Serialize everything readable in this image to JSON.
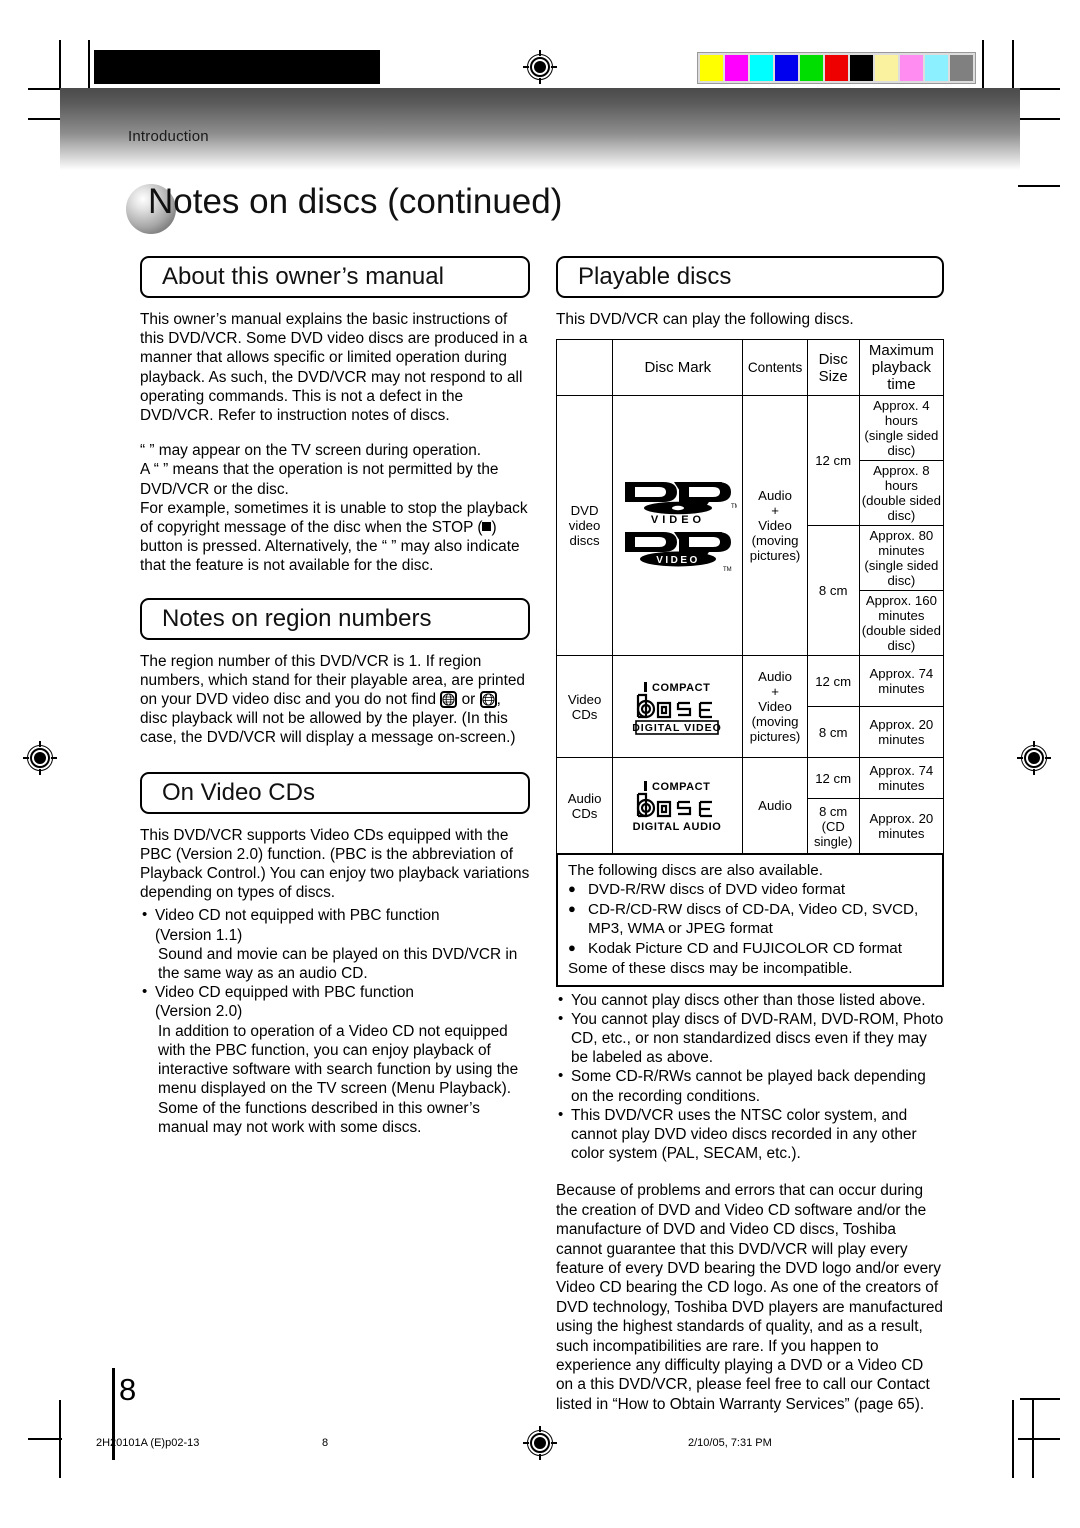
{
  "header": {
    "section_label": "Introduction",
    "page_title": "Notes on discs (continued)",
    "color_bar": [
      "#FFFF00",
      "#FF00FF",
      "#00FFFF",
      "#0000EE",
      "#00DD00",
      "#EE0000",
      "#000000",
      "#FBF2A0",
      "#FF8CF0",
      "#8CF0FF",
      "#808080"
    ]
  },
  "left": {
    "about": {
      "heading": "About this owner’s manual",
      "p1": "This owner’s manual explains the basic instructions of this DVD/VCR. Some DVD video discs are produced in a manner that allows specific or limited operation during playback. As such, the DVD/VCR may not respond to all operating commands. This is not a defect in the DVD/VCR. Refer to instruction notes of discs.",
      "p2_a": "“      ” may appear on the TV screen during operation.",
      "p2_b": "A “      ” means that the operation is not permitted by the DVD/VCR or the disc.",
      "p2_c_1": "For example, sometimes it is unable to stop the playback of copyright message of the disc when the STOP (",
      "p2_c_2": ") button is pressed. Alternatively, the “      ” may also indicate that the feature is not available for the disc."
    },
    "region": {
      "heading": "Notes on region numbers",
      "p1_a": "The region number of this DVD/VCR is 1. If region numbers, which stand for their playable area, are printed on your DVD video disc and you do not find",
      "p1_b": "or",
      "p1_c": ", disc playback will not be allowed by the player. (In this case, the DVD/VCR will display a message on-screen.)"
    },
    "videocds": {
      "heading": "On Video CDs",
      "p1": "This DVD/VCR supports Video CDs equipped with the PBC (Version 2.0) function. (PBC is the abbreviation of Playback Control.) You can enjoy two playback variations depending on types of discs.",
      "bullets": [
        {
          "title": "Video CD not equipped with PBC function",
          "version": "(Version 1.1)",
          "detail": "Sound and movie can be played on this DVD/VCR in the same way as an audio CD."
        },
        {
          "title": "Video CD equipped with PBC function",
          "version": "(Version 2.0)",
          "detail": "In addition to operation of a Video CD not equipped with the PBC function, you can enjoy playback of interactive software with search function by using the menu displayed on the TV screen (Menu Playback). Some of the functions described in this owner’s manual may not work with some discs."
        }
      ]
    }
  },
  "right": {
    "playable": {
      "heading": "Playable discs",
      "intro": "This DVD/VCR can play the following discs.",
      "table": {
        "columns": [
          "",
          "Disc Mark",
          "Contents",
          "Disc Size",
          "Maximum playback time"
        ],
        "col_disc_size_l1": "Disc",
        "col_disc_size_l2": "Size",
        "col_max_l1": "Maximum",
        "col_max_l2": "playback time",
        "rows": [
          {
            "name_l1": "DVD",
            "name_l2": "video",
            "name_l3": "discs",
            "mark": "dvd-video-logo",
            "contents": "Audio\n+\nVideo\n(moving\npictures)",
            "contents_lines": [
              "Audio",
              "+",
              "Video",
              "(moving",
              "pictures)"
            ],
            "sizes": [
              {
                "size": "12 cm",
                "times": [
                  "Approx. 4 hours\n(single sided disc)",
                  "Approx. 8 hours\n(double sided disc)"
                ],
                "times_lines": [
                  [
                    "Approx. 4 hours",
                    "(single sided disc)"
                  ],
                  [
                    "Approx. 8 hours",
                    "(double sided disc)"
                  ]
                ]
              },
              {
                "size": "8 cm",
                "times": [
                  "Approx. 80 minutes\n(single sided disc)",
                  "Approx. 160 minutes\n(double sided disc)"
                ],
                "times_lines": [
                  [
                    "Approx. 80 minutes",
                    "(single sided disc)"
                  ],
                  [
                    "Approx. 160 minutes",
                    "(double sided disc)"
                  ]
                ]
              }
            ]
          },
          {
            "name_l1": "Video",
            "name_l2": "CDs",
            "mark": "compact-disc-digital-video-logo",
            "contents_lines": [
              "Audio",
              "+",
              "Video",
              "(moving",
              "pictures)"
            ],
            "sizes": [
              {
                "size": "12 cm",
                "times_lines": [
                  [
                    "Approx. 74 minutes"
                  ]
                ]
              },
              {
                "size": "8 cm",
                "times_lines": [
                  [
                    "Approx. 20 minutes"
                  ]
                ]
              }
            ]
          },
          {
            "name_l1": "Audio",
            "name_l2": "CDs",
            "mark": "compact-disc-digital-audio-logo",
            "contents_lines": [
              "Audio"
            ],
            "sizes": [
              {
                "size": "12 cm",
                "times_lines": [
                  [
                    "Approx. 74 minutes"
                  ]
                ]
              },
              {
                "size_l1": "8 cm",
                "size_l2": "(CD",
                "size_l3": "single)",
                "times_lines": [
                  [
                    "Approx. 20 minutes"
                  ]
                ]
              }
            ]
          }
        ]
      },
      "also_box": {
        "lead": "The following discs are also available.",
        "items": [
          "DVD-R/RW discs of DVD video format",
          "CD-R/CD-RW discs of CD-DA, Video CD, SVCD,",
          "Kodak Picture CD and FUJICOLOR CD format"
        ],
        "item2_cont": "MP3, WMA or JPEG format",
        "tail": "Some of these discs may be incompatible."
      },
      "notes": [
        "You cannot play discs other than those listed above.",
        "You cannot play discs of DVD-RAM, DVD-ROM, Photo CD, etc., or non standardized discs even if they may be labeled as above.",
        "Some CD-R/RWs cannot be played back depending on the recording conditions.",
        "This DVD/VCR uses the NTSC color system, and cannot play DVD video discs recorded in any other color system (PAL, SECAM, etc.)."
      ],
      "closing": "Because of problems and errors that can occur during the creation of DVD and Video CD software and/or the manufacture of DVD and Video CD discs, Toshiba cannot guarantee that this DVD/VCR will play every feature of every DVD bearing the DVD logo and/or every Video CD bearing the CD logo. As one of the creators of DVD technology, Toshiba DVD players are manufactured using the highest standards of quality, and as a result, such incompatibilities are rare. If you happen to experience any difficulty playing a DVD or a Video CD on a this DVD/VCR, please feel free to call our Contact listed in “How to Obtain Warranty Services” (page 65)."
    }
  },
  "footer": {
    "page_number": "8",
    "file_id": "2H20101A (E)p02-13",
    "folio": "8",
    "timestamp": "2/10/05, 7:31 PM"
  },
  "logos": {
    "dvd_video_top": "DVD",
    "dvd_video_top_sub": "V I D E O",
    "dvd_video_bottom": "DVD",
    "dvd_video_bottom_sub": "VIDEO",
    "cd_compact": "COMPACT",
    "cd_word": "disc",
    "cd_digital_video": "DIGITAL VIDEO",
    "cd_digital_audio": "DIGITAL AUDIO",
    "tm": "TM"
  }
}
